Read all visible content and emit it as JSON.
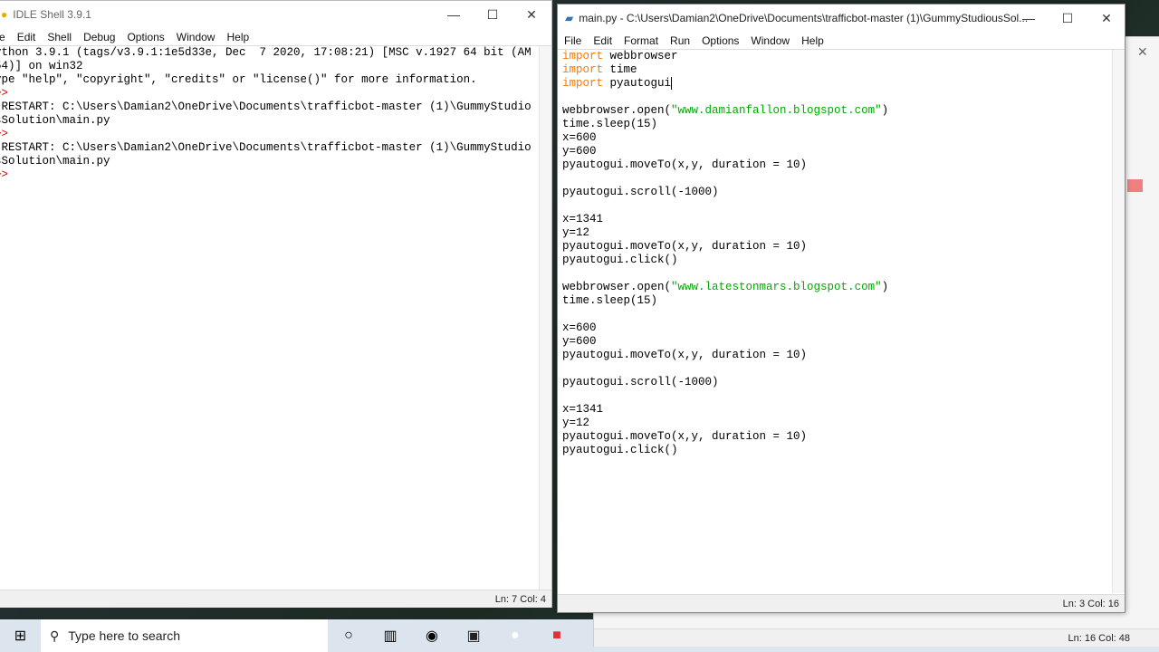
{
  "shell": {
    "title": "IDLE Shell 3.9.1",
    "menu": [
      "e",
      "Edit",
      "Shell",
      "Debug",
      "Options",
      "Window",
      "Help"
    ],
    "lines": [
      {
        "text": "ython 3.9.1 (tags/v3.9.1:1e5d33e, Dec  7 2020, 17:08:21) [MSC v.1927 64 bit (AM",
        "type": "out"
      },
      {
        "text": "54)] on win32",
        "type": "out"
      },
      {
        "text": "ype \"help\", \"copyright\", \"credits\" or \"license()\" for more information.",
        "type": "out"
      },
      {
        "text": ">>",
        "type": "prompt"
      },
      {
        "text": " RESTART: C:\\Users\\Damian2\\OneDrive\\Documents\\trafficbot-master (1)\\GummyStudio",
        "type": "out"
      },
      {
        "text": "sSolution\\main.py",
        "type": "out"
      },
      {
        "text": ">>",
        "type": "prompt"
      },
      {
        "text": " RESTART: C:\\Users\\Damian2\\OneDrive\\Documents\\trafficbot-master (1)\\GummyStudio",
        "type": "out"
      },
      {
        "text": "sSolution\\main.py",
        "type": "out"
      },
      {
        "text": ">>",
        "type": "prompt"
      }
    ],
    "status": "Ln: 7   Col: 4"
  },
  "editor": {
    "title": "main.py - C:\\Users\\Damian2\\OneDrive\\Documents\\trafficbot-master (1)\\GummyStudiousSol...",
    "menu": [
      "File",
      "Edit",
      "Format",
      "Run",
      "Options",
      "Window",
      "Help"
    ],
    "lines": [
      [
        [
          "kw",
          "import"
        ],
        [
          "p",
          " webbrowser"
        ]
      ],
      [
        [
          "kw",
          "import"
        ],
        [
          "p",
          " time"
        ]
      ],
      [
        [
          "kw",
          "import"
        ],
        [
          "p",
          " pyautogui"
        ]
      ],
      [],
      [
        [
          "p",
          "webbrowser.open("
        ],
        [
          "str",
          "\"www.damianfallon.blogspot.com\""
        ],
        [
          "p",
          ")"
        ]
      ],
      [
        [
          "p",
          "time.sleep(15)"
        ]
      ],
      [
        [
          "p",
          "x=600"
        ]
      ],
      [
        [
          "p",
          "y=600"
        ]
      ],
      [
        [
          "p",
          "pyautogui.moveTo(x,y, duration = 10)"
        ]
      ],
      [],
      [
        [
          "p",
          "pyautogui.scroll(-1000)"
        ]
      ],
      [],
      [
        [
          "p",
          "x=1341"
        ]
      ],
      [
        [
          "p",
          "y=12"
        ]
      ],
      [
        [
          "p",
          "pyautogui.moveTo(x,y, duration = 10)"
        ]
      ],
      [
        [
          "p",
          "pyautogui.click()"
        ]
      ],
      [],
      [
        [
          "p",
          "webbrowser.open("
        ],
        [
          "str",
          "\"www.latestonmars.blogspot.com\""
        ],
        [
          "p",
          ")"
        ]
      ],
      [
        [
          "p",
          "time.sleep(15)"
        ]
      ],
      [],
      [
        [
          "p",
          "x=600"
        ]
      ],
      [
        [
          "p",
          "y=600"
        ]
      ],
      [
        [
          "p",
          "pyautogui.moveTo(x,y, duration = 10)"
        ]
      ],
      [],
      [
        [
          "p",
          "pyautogui.scroll(-1000)"
        ]
      ],
      [],
      [
        [
          "p",
          "x=1341"
        ]
      ],
      [
        [
          "p",
          "y=12"
        ]
      ],
      [
        [
          "p",
          "pyautogui.moveTo(x,y, duration = 10)"
        ]
      ],
      [
        [
          "p",
          "pyautogui.click()"
        ]
      ]
    ],
    "status": "Ln: 3   Col: 16"
  },
  "back_window": {
    "status": "Ln: 16   Col: 48"
  },
  "taskbar": {
    "search_placeholder": "Type here to search",
    "icons": [
      "windows-start-icon",
      "search-icon",
      "cortana-icon",
      "task-view-icon",
      "app-icon",
      "store-icon",
      "hp-icon",
      "paint-icon"
    ]
  },
  "colors": {
    "keyword": "#ff7700",
    "string": "#00aa00",
    "prompt": "#cc0000"
  }
}
